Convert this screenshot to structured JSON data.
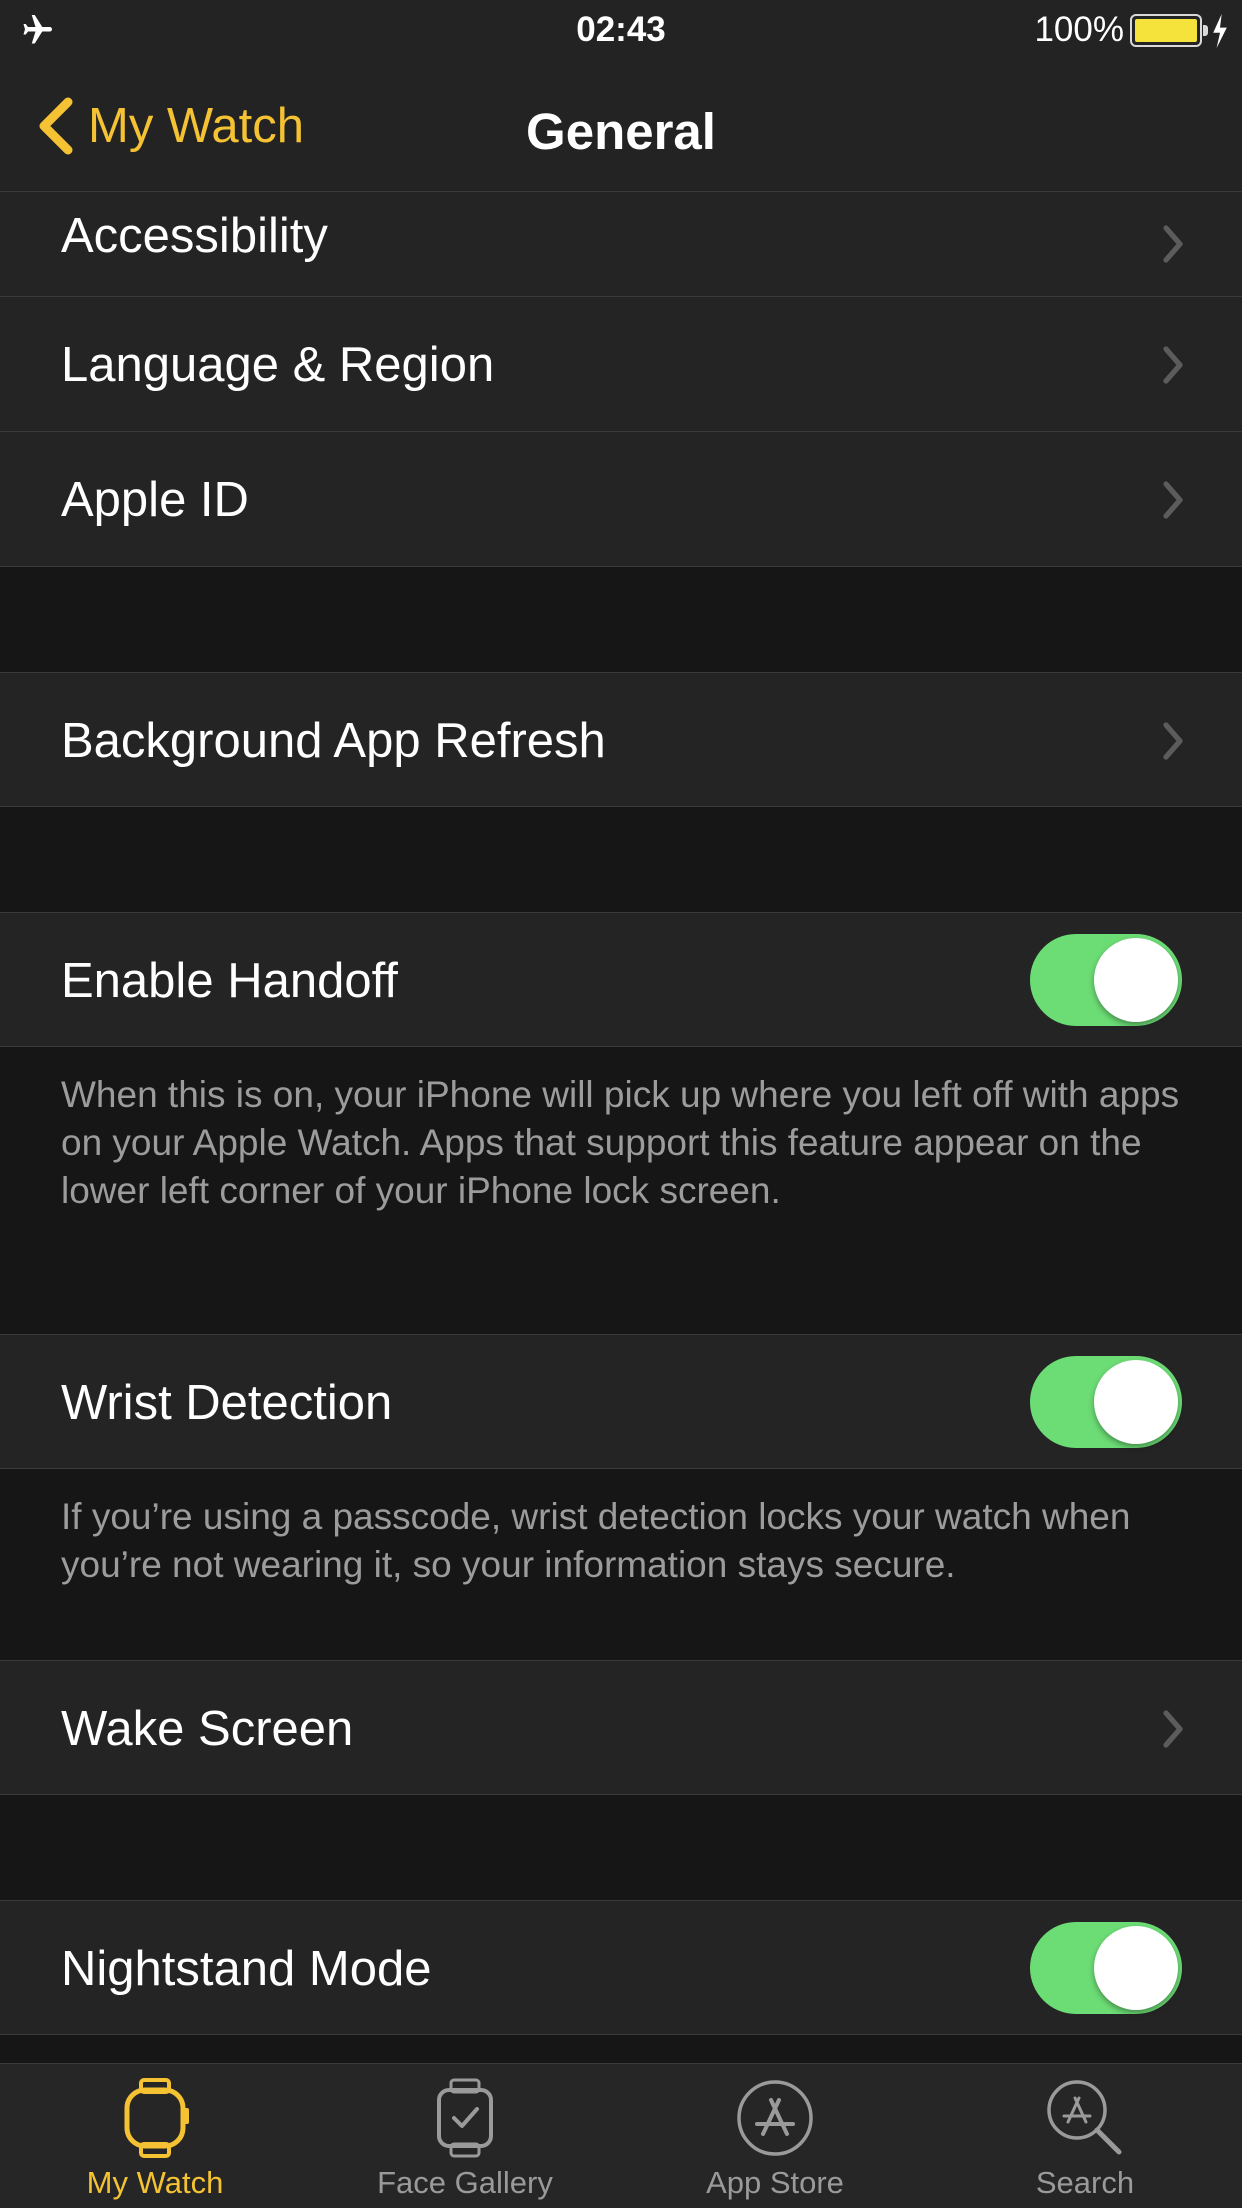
{
  "status_bar": {
    "time": "02:43",
    "battery_percent": "100%",
    "icons": [
      "airplane-icon",
      "battery-icon",
      "charging-bolt-icon"
    ]
  },
  "nav": {
    "back_label": "My Watch",
    "title": "General"
  },
  "rows": {
    "accessibility": "Accessibility",
    "language_region": "Language & Region",
    "apple_id": "Apple ID",
    "background_app_refresh": "Background App Refresh",
    "enable_handoff": "Enable Handoff",
    "enable_handoff_on": true,
    "handoff_footer": "When this is on, your iPhone will pick up where you left off with apps on your Apple Watch. Apps that support this feature appear on the lower left corner of your iPhone lock screen.",
    "wrist_detection": "Wrist Detection",
    "wrist_detection_on": true,
    "wrist_footer": "If you’re using a passcode, wrist detection locks your watch when you’re not wearing it, so your information stays secure.",
    "wake_screen": "Wake Screen",
    "nightstand_mode": "Nightstand Mode",
    "nightstand_mode_on": true
  },
  "tabs": [
    {
      "label": "My Watch",
      "icon": "watch-icon",
      "active": true
    },
    {
      "label": "Face Gallery",
      "icon": "face-gallery-icon",
      "active": false
    },
    {
      "label": "App Store",
      "icon": "app-store-icon",
      "active": false
    },
    {
      "label": "Search",
      "icon": "search-icon",
      "active": false
    }
  ],
  "colors": {
    "accent": "#f5c233",
    "toggle_on": "#6cdc75",
    "background": "#161616",
    "cell": "#242424",
    "secondary_text": "#9c9c9c"
  }
}
